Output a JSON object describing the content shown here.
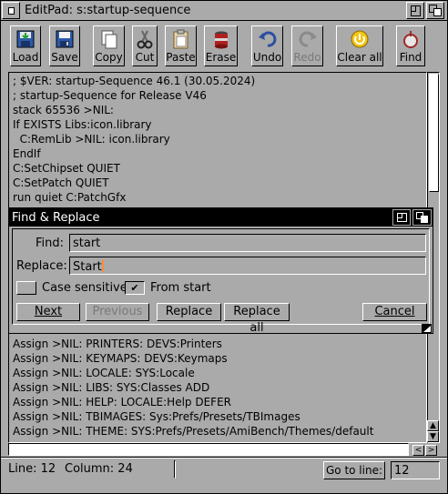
{
  "window": {
    "title": "EditPad: s:startup-sequence"
  },
  "toolbar": {
    "buttons": [
      {
        "label": "Load",
        "icon": "load-icon"
      },
      {
        "label": "Save",
        "icon": "save-icon"
      },
      {
        "label": "Copy",
        "icon": "copy-icon"
      },
      {
        "label": "Cut",
        "icon": "cut-icon"
      },
      {
        "label": "Paste",
        "icon": "paste-icon"
      },
      {
        "label": "Erase",
        "icon": "erase-icon"
      },
      {
        "label": "Undo",
        "icon": "undo-icon"
      },
      {
        "label": "Redo",
        "icon": "redo-icon"
      },
      {
        "label": "Clear all",
        "icon": "clear-all-icon"
      },
      {
        "label": "Find",
        "icon": "find-icon"
      }
    ]
  },
  "editor": {
    "lines_top": [
      "; $VER: startup-Sequence 46.1 (30.05.2024)",
      "; startup-Sequence for Release V46",
      "stack 65536 >NIL:",
      "If EXISTS Libs:icon.library",
      "  C:RemLib >NIL: icon.library",
      "EndIf",
      "C:SetChipset QUIET",
      "C:SetPatch QUIET",
      "run quiet C:PatchGfx"
    ],
    "lines_bottom": [
      "Assign >NIL: PRINTERS: DEVS:Printers",
      "Assign >NIL: KEYMAPS: DEVS:Keymaps",
      "Assign >NIL: LOCALE: SYS:Locale",
      "Assign >NIL: LIBS: SYS:Classes ADD",
      "Assign >NIL: HELP: LOCALE:Help DEFER",
      "Assign >NIL: TBIMAGES: Sys:Prefs/Presets/TBImages",
      "Assign >NIL: THEME: SYS:Prefs/Presets/AmiBench/Themes/default"
    ]
  },
  "find_dialog": {
    "title": "Find & Replace",
    "find_label": "Find:",
    "find_value": "start",
    "replace_label": "Replace:",
    "replace_value": "Start",
    "case_sensitive_label": "Case sensitive",
    "case_sensitive_checked": false,
    "from_start_label": "From start",
    "from_start_checked": true,
    "buttons": {
      "next": "Next",
      "previous": "Previous",
      "replace": "Replace",
      "replace_all": "Replace all",
      "cancel": "Cancel"
    }
  },
  "status": {
    "line_label": "Line: 12",
    "column_label": "Column: 24",
    "goto_label": "Go to line:",
    "goto_value": "12"
  }
}
